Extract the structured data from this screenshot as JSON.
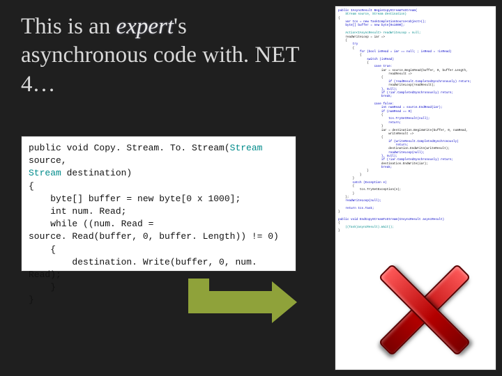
{
  "title_prefix": "This is an ",
  "title_expert": "expert",
  "title_suffix": "'s asynchronous code with. NET 4…",
  "simple_code": {
    "l1a": "public void Copy. Stream. To. Stream(",
    "l1b": "Stream",
    "l1c": " source, ",
    "l2a": "Stream",
    "l2b": " destination)",
    "l3": "{",
    "l4": "    byte[] buffer = new byte[0 x 1000];",
    "l5": "    int num. Read;",
    "l6": "    while ((num. Read =",
    "l7": "source. Read(buffer, 0, buffer. Length)) != 0)",
    "l8": "    {",
    "l9": "        destination. Write(buffer, 0, num. Read);",
    "l10": "    }",
    "l11": "}"
  },
  "complex_code": {
    "c1": "public IAsyncResult BeginCopyStreamToStream(",
    "c2": "    Stream source, Stream destination)",
    "c3": "{",
    "c4": "    var tcs = new TaskCompletionSource<object>();",
    "c5": "    byte[] buffer = new byte[0x1000];",
    "c6": "",
    "c7": "    Action<IAsyncResult> readWriteLoop = null;",
    "c8": "    readWriteLoop = iar =>",
    "c9": "    {",
    "c10": "        try",
    "c11": "        {",
    "c12": "            for (bool isRead = iar == null; ; isRead = !isRead)",
    "c13": "            {",
    "c14": "                switch (isRead)",
    "c15": "                {",
    "c16": "                    case true:",
    "c17": "                        iar = source.BeginRead(buffer, 0, buffer.Length,",
    "c18": "                            readResult =>",
    "c19": "                        {",
    "c20": "                            if (readResult.CompletedSynchronously) return;",
    "c21": "                            readWriteLoop(readResult);",
    "c22": "                        }, null);",
    "c23": "                        if (!iar.CompletedSynchronously) return;",
    "c24": "                        break;",
    "c25": "",
    "c26": "                    case false:",
    "c27": "                        int numRead = source.EndRead(iar);",
    "c28": "                        if (numRead == 0)",
    "c29": "                        {",
    "c30": "                            tcs.TrySetResult(null);",
    "c31": "                            return;",
    "c32": "                        }",
    "c33": "                        iar = destination.BeginWrite(buffer, 0, numRead,",
    "c34": "                            writeResult =>",
    "c35": "                        {",
    "c36": "                            if (writeResult.CompletedSynchronously)",
    "c37": "                                return;",
    "c38": "                            destination.EndWrite(writeResult);",
    "c39": "                            readWriteLoop(null);",
    "c40": "                        }, null);",
    "c41": "                        if (!iar.CompletedSynchronously) return;",
    "c42": "                        destination.EndWrite(iar);",
    "c43": "                        break;",
    "c44": "                }",
    "c45": "            }",
    "c46": "        }",
    "c47": "        catch (Exception e)",
    "c48": "        {",
    "c49": "            tcs.TrySetException(e);",
    "c50": "        }",
    "c51": "    };",
    "c52": "    readWriteLoop(null);",
    "c53": "",
    "c54": "    return tcs.Task;",
    "c55": "}",
    "c56": "",
    "c57": "public void EndCopyStreamToStream(IAsyncResult asyncResult)",
    "c58": "{",
    "c59": "    ((Task)asyncResult).Wait();",
    "c60": "}"
  }
}
